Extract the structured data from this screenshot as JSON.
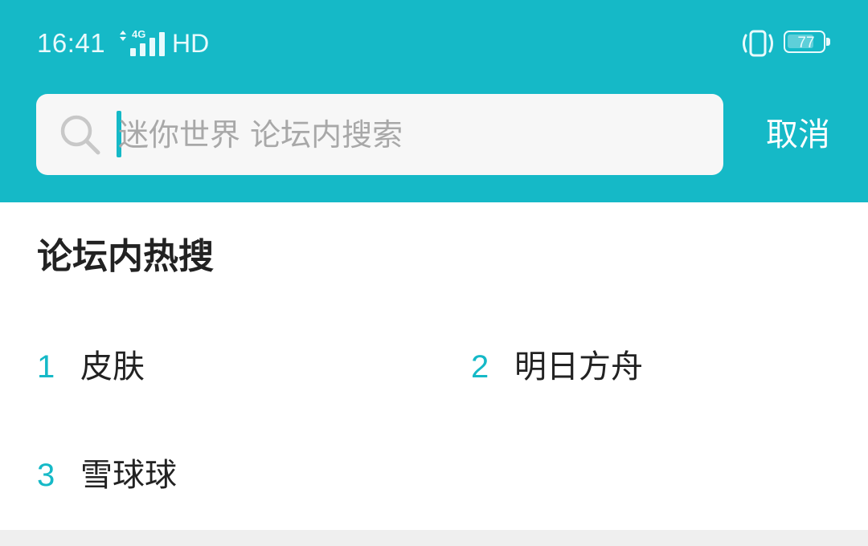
{
  "colors": {
    "accent": "#15b9c7",
    "header_text": "#e9fafc",
    "search_bg": "#f7f7f7",
    "placeholder": "#a8a8a8",
    "title_text": "#222222",
    "divider": "#efefef"
  },
  "status_bar": {
    "time": "16:41",
    "network_type": "4G",
    "hd_label": "HD",
    "battery_level": "77",
    "icons": [
      "data-arrows-icon",
      "signal-bars-icon",
      "vibrate-icon",
      "battery-icon"
    ]
  },
  "search": {
    "placeholder": "迷你世界 论坛内搜索",
    "value": "",
    "icon": "search-icon"
  },
  "cancel_label": "取消",
  "hot_search": {
    "title": "论坛内热搜",
    "items": [
      {
        "rank": "1",
        "label": "皮肤"
      },
      {
        "rank": "2",
        "label": "明日方舟"
      },
      {
        "rank": "3",
        "label": "雪球球"
      }
    ]
  }
}
